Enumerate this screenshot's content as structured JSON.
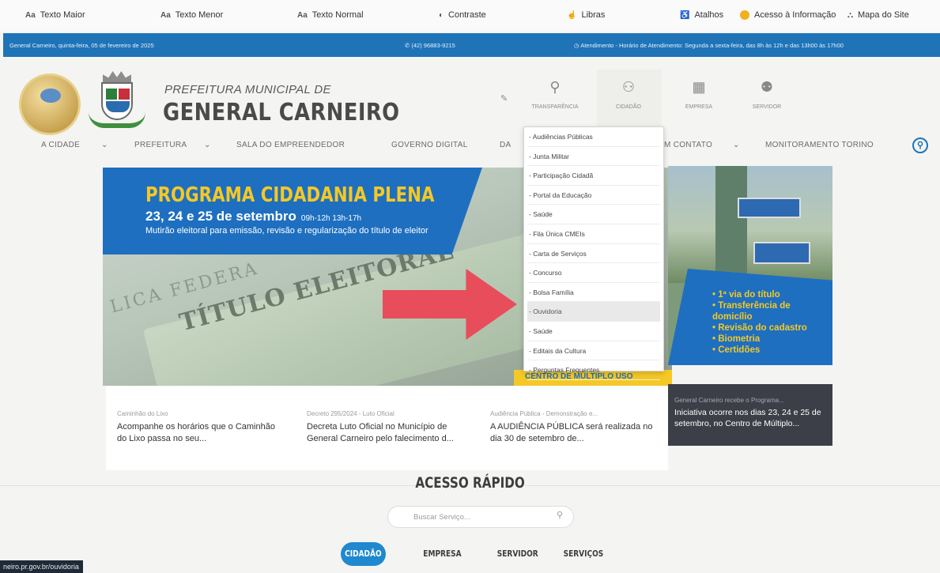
{
  "accessibility": {
    "items": [
      {
        "icon": "Aa",
        "label": "Texto Maior"
      },
      {
        "icon": "Aa",
        "label": "Texto Menor"
      },
      {
        "icon": "Aa",
        "label": "Texto Normal"
      },
      {
        "icon": "contrast-icon",
        "label": "Contraste"
      },
      {
        "icon": "hand-icon",
        "label": "Libras"
      },
      {
        "icon": "accessibility-icon",
        "label": "Atalhos"
      },
      {
        "icon": "info-icon",
        "label": "Acesso à Informação"
      },
      {
        "icon": "sitemap-icon",
        "label": "Mapa do Site"
      }
    ]
  },
  "info_bar": {
    "date": "General Carneiro, quinta-feira, 05 de fevereiro de 2025",
    "phone": "(42) 96883-9215",
    "hours": "Atendimento - Horário de Atendimento: Segunda a sexta-feira, das 8h às 12h e das 13h00 às 17h00"
  },
  "header": {
    "org_small": "PREFEITURA MUNICIPAL DE",
    "org_big": "GENERAL CARNEIRO",
    "icons": [
      {
        "label": "TRANSPARÊNCIA"
      },
      {
        "label": "CIDADÃO"
      },
      {
        "label": "EMPRESA"
      },
      {
        "label": "SERVIDOR"
      }
    ]
  },
  "nav": {
    "items": [
      "A CIDADE",
      "PREFEITURA",
      "SALA DO EMPREENDEDOR",
      "GOVERNO DIGITAL",
      "DA",
      "M CONTATO",
      "MONITORAMENTO TORINO"
    ],
    "chevron": "⌄"
  },
  "dropdown": {
    "items": [
      "- Audiências Públicas",
      "- Junta Militar",
      "- Participação Cidadã",
      "- Portal da Educação",
      "- Saúde",
      "- Fila Única CMEIs",
      "- Carta de Serviços",
      "- Concurso",
      "- Bolsa Família",
      "- Ouvidoria",
      "- Saúde",
      "- Editais da Cultura",
      "- Perguntas Frequentes"
    ],
    "active_index": 9
  },
  "banner": {
    "title": "PROGRAMA CIDADANIA PLENA",
    "date": "23, 24 e 25 de setembro",
    "time": "09h-12h 13h-17h",
    "subtitle": "Mutirão eleitoral para emissão, revisão e regularização do título de eleitor",
    "card_text": "TÍTULO ELEITORAL",
    "card_text2": "LICA FEDERA",
    "footer": "CENTRO DE MÚLTIPLO USO",
    "services": [
      "1ª via do título",
      "Transferência de domicílio",
      "Revisão do cadastro",
      "Biometria",
      "Certidões"
    ]
  },
  "news": [
    {
      "cat": "Caminhão do Lixo",
      "title": "Acompanhe os horários que o Caminhão do Lixo passa no seu..."
    },
    {
      "cat": "Decreto 295/2024 - Luto Oficial",
      "title": "Decreta Luto Oficial no Município de General Carneiro pelo falecimento d..."
    },
    {
      "cat": "Audiência Pública - Demonstração e...",
      "title": "A AUDIÊNCIA PÚBLICA será realizada no dia 30 de setembro de..."
    },
    {
      "cat": "General Carneiro recebe o Programa...",
      "title": "Iniciativa ocorre nos dias 23, 24 e 25 de setembro, no Centro de Múltiplo..."
    }
  ],
  "quick_access": {
    "title": "ACESSO RÁPIDO",
    "search_placeholder": "Buscar Serviço...",
    "tabs": [
      "CIDADÃO",
      "EMPRESA",
      "SERVIDOR",
      "SERVIÇOS"
    ],
    "active_tab": 0
  },
  "status_bar": {
    "url": "neiro.pr.gov.br/ouvidoria"
  },
  "colors": {
    "primary_blue": "#1f74b8",
    "banner_blue": "#1e6fc0",
    "accent_yellow": "#f5c825",
    "arrow_red": "#e84d5b"
  }
}
